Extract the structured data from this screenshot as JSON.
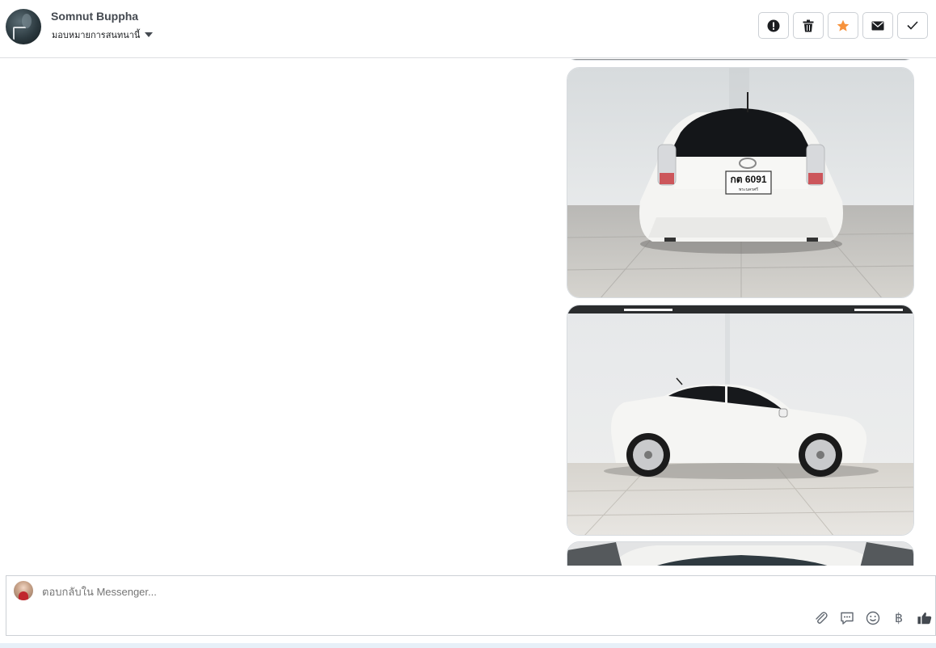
{
  "header": {
    "contact_name": "Somnut Buppha",
    "assign_label": "มอบหมายการสนทนานี้",
    "actions": [
      {
        "name": "report-button",
        "icon": "exclamation-circle-icon"
      },
      {
        "name": "delete-button",
        "icon": "trash-icon"
      },
      {
        "name": "star-button",
        "icon": "star-icon",
        "color": "#f7923b"
      },
      {
        "name": "mark-unread-button",
        "icon": "envelope-icon"
      },
      {
        "name": "mark-done-button",
        "icon": "checkmark-icon"
      }
    ]
  },
  "thread": {
    "photos": [
      {
        "name": "car-rear-photo",
        "plate_main": "กต 6091",
        "plate_sub": "พระนครศรี"
      },
      {
        "name": "car-side-photo"
      },
      {
        "name": "car-engine-photo"
      }
    ]
  },
  "composer": {
    "placeholder": "ตอบกลับใน Messenger...",
    "tools": [
      "paperclip-icon",
      "saved-reply-icon",
      "emoji-icon",
      "baht-icon",
      "thumbs-up-icon"
    ],
    "baht_symbol": "฿"
  },
  "colors": {
    "star": "#f7923b",
    "icon": "#444950",
    "border": "#ccd0d5"
  }
}
